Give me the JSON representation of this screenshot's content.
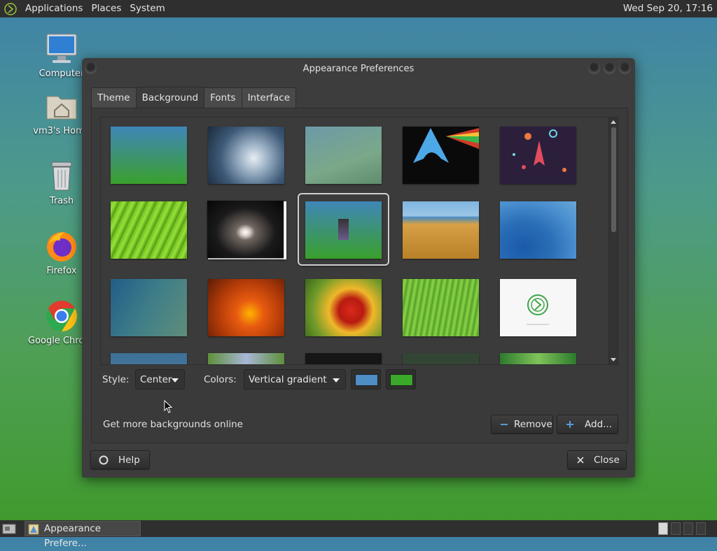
{
  "top_panel": {
    "menus": [
      "Applications",
      "Places",
      "System"
    ],
    "clock": "Wed Sep 20, 17:16"
  },
  "desktop": {
    "icons": [
      {
        "label": "Computer",
        "icon": "computer-icon"
      },
      {
        "label": "vm3's Home",
        "icon": "home-folder-icon"
      },
      {
        "label": "Trash",
        "icon": "trash-icon"
      },
      {
        "label": "Firefox",
        "icon": "firefox-icon"
      },
      {
        "label": "Google Chrome",
        "icon": "chrome-icon"
      }
    ]
  },
  "window": {
    "title": "Appearance Preferences",
    "tabs": [
      "Theme",
      "Background",
      "Fonts",
      "Interface"
    ],
    "active_tab": "Background",
    "backgrounds": [
      {
        "name": "green-blue-gradient",
        "selected": false
      },
      {
        "name": "water-drop",
        "selected": false
      },
      {
        "name": "blurred-sea-green",
        "selected": false
      },
      {
        "name": "arch-prism",
        "selected": false
      },
      {
        "name": "space-rocket",
        "selected": false
      },
      {
        "name": "green-leaf",
        "selected": false
      },
      {
        "name": "sombrero-galaxy",
        "selected": false
      },
      {
        "name": "gradient-with-logo",
        "selected": true
      },
      {
        "name": "dune-grass",
        "selected": false
      },
      {
        "name": "blue-waves",
        "selected": false
      },
      {
        "name": "blue-bokeh",
        "selected": false
      },
      {
        "name": "orange-flower",
        "selected": false
      },
      {
        "name": "red-flower",
        "selected": false
      },
      {
        "name": "green-grass",
        "selected": false
      },
      {
        "name": "white-logo",
        "selected": false
      }
    ],
    "style_label": "Style:",
    "style_value": "Center",
    "colors_label": "Colors:",
    "colors_value": "Vertical gradient",
    "color1": "#4f8dc5",
    "color2": "#3aa829",
    "online_link": "Get more backgrounds online",
    "remove_label": "Remove",
    "add_label": "Add...",
    "help_label": "Help",
    "close_label": "Close"
  },
  "bottom_panel": {
    "task_label": "Appearance Prefere..."
  }
}
